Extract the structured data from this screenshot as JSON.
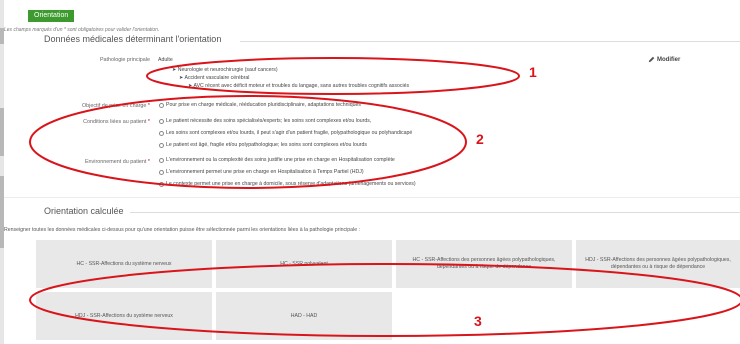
{
  "tab": {
    "label": "Orientation"
  },
  "required_note": "Les champs marqués d'un * sont obligatoires pour valider l'orientation.",
  "section_medical": {
    "title": "Données médicales déterminant l'orientation",
    "pathology": {
      "label": "Pathologie principale",
      "value_prefix": "Adulte",
      "tree": [
        "➤ Neurologie et neurochirurgie (sauf cancers)",
        "➤ Accident vasculaire cérébral",
        "➤ AVC récent avec déficit moteur et troubles du langage, sans autres troubles cognitifs associés"
      ],
      "modifier_label": "Modifier"
    },
    "objective": {
      "label": "Objectif de prise en charge",
      "options": [
        "Pour prise en charge médicale, rééducation pluridisciplinaire, adaptations techniques"
      ]
    },
    "conditions": {
      "label": "Conditions liées au patient",
      "options": [
        "Le patient nécessite des soins spécialisés/experts; les soins sont complexes et/ou lourds,",
        "Les soins sont complexes et/ou lourds, il peut s'agir d'un patient fragile, polypathologique ou polyhandicapé",
        "Le patient est âgé, fragile et/ou polypathologique; les soins sont complexes et/ou lourds"
      ]
    },
    "environment": {
      "label": "Environnement du patient",
      "options": [
        "L'environnement ou la complexité des soins justifie une prise en charge en Hospitalisation complète",
        "L'environnement permet une prise en charge en Hospitalisation à Temps Partiel (HDJ)",
        "Le contexte permet une prise en charge à domicile, sous réserve d'adaptations (aménagements ou services)"
      ]
    }
  },
  "section_orientation": {
    "title": "Orientation calculée",
    "instruction": "Renseigner toutes les données médicales ci-dessus pour qu'une orientation puisse être sélectionnée parmi les orientations liées à la pathologie principale :",
    "row1": [
      "HC - SSR-Affections du système nerveux",
      "HC - SSR polyvalent",
      "HC - SSR-Affections des personnes âgées polypathologiques, dépendantes ou à risque de dépendance",
      "HDJ - SSR-Affections des personnes âgées polypathologiques, dépendantes ou à risque de dépendance"
    ],
    "row2": [
      "HDJ - SSR-Affections du système nerveux",
      "HAD - HAD"
    ]
  },
  "annotations": {
    "n1": "1",
    "n2": "2",
    "n3": "3",
    "color": "#d9141a"
  },
  "colors": {
    "tab_green": "#3c9a2f",
    "required_red": "#cc0000"
  }
}
